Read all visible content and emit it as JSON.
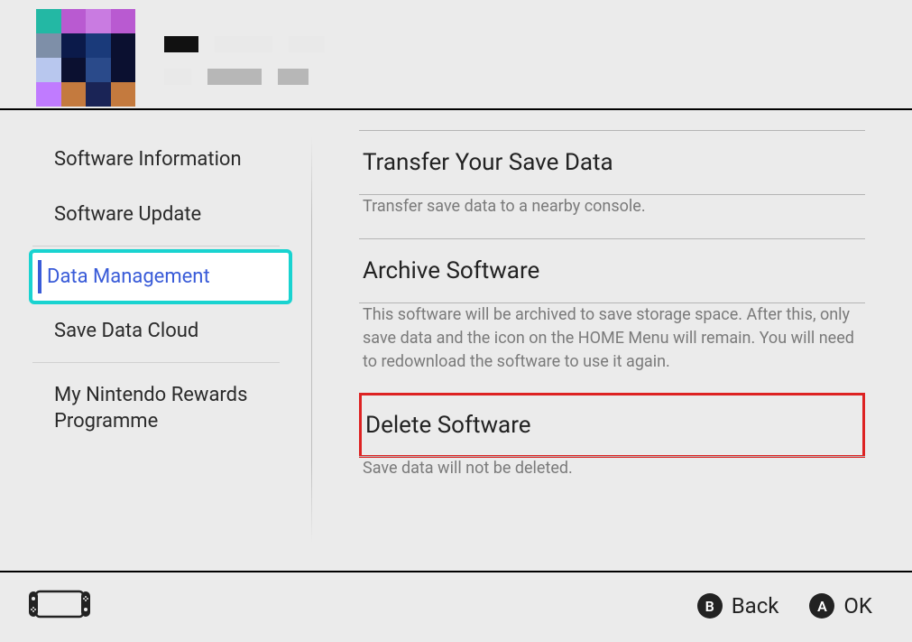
{
  "sidebar": {
    "items": [
      {
        "label": "Software Information"
      },
      {
        "label": "Software Update"
      },
      {
        "label": "Data Management",
        "selected": true
      },
      {
        "label": "Save Data Cloud"
      },
      {
        "label": "My Nintendo Rewards Programme"
      }
    ]
  },
  "panels": {
    "transfer": {
      "title": "Transfer Your Save Data",
      "desc": "Transfer save data to a nearby console."
    },
    "archive": {
      "title": "Archive Software",
      "desc": "This software will be archived to save storage space. After this, only save data and the icon on the HOME Menu will remain. You will need to redownload the software to use it again."
    },
    "delete": {
      "title": "Delete Software",
      "desc": "Save data will not be deleted."
    }
  },
  "footer": {
    "back": {
      "button": "B",
      "label": "Back"
    },
    "ok": {
      "button": "A",
      "label": "OK"
    }
  }
}
